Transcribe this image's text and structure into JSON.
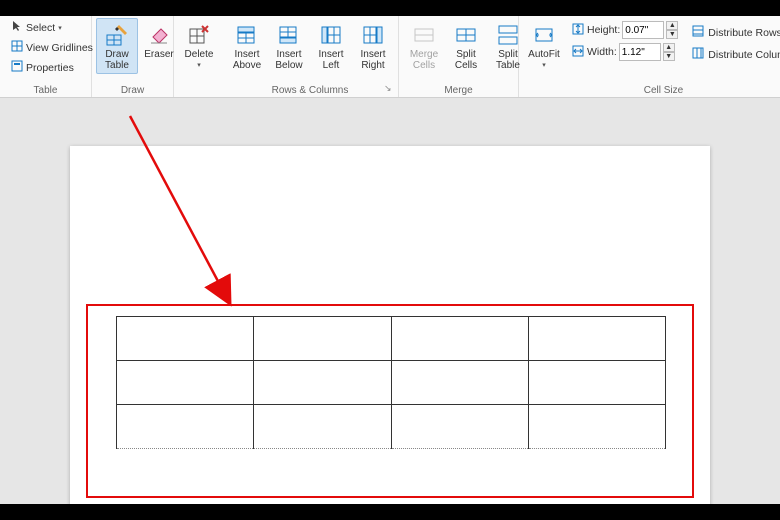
{
  "ribbon": {
    "tableGroup": {
      "label": "Table",
      "select": "Select",
      "viewGridlines": "View Gridlines",
      "properties": "Properties"
    },
    "drawGroup": {
      "label": "Draw",
      "drawTable": "Draw\nTable",
      "eraser": "Eraser"
    },
    "deleteGroup": {
      "delete": "Delete"
    },
    "rowsColsGroup": {
      "label": "Rows & Columns",
      "insertAbove": "Insert\nAbove",
      "insertBelow": "Insert\nBelow",
      "insertLeft": "Insert\nLeft",
      "insertRight": "Insert\nRight"
    },
    "mergeGroup": {
      "label": "Merge",
      "mergeCells": "Merge\nCells",
      "splitCells": "Split\nCells",
      "splitTable": "Split\nTable"
    },
    "cellSizeGroup": {
      "label": "Cell Size",
      "autofit": "AutoFit",
      "heightLabel": "Height:",
      "heightValue": "0.07\"",
      "widthLabel": "Width:",
      "widthValue": "1.12\"",
      "distRows": "Distribute Rows",
      "distCols": "Distribute Columns"
    }
  }
}
